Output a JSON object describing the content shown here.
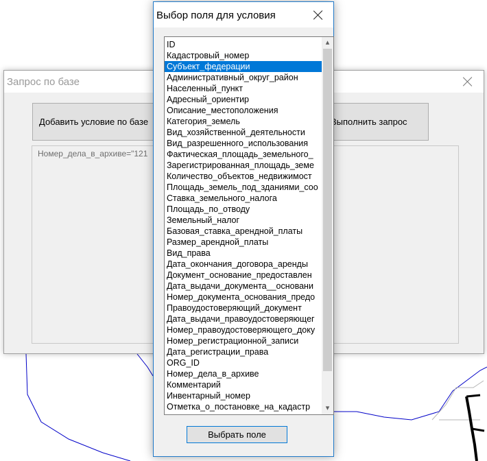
{
  "query_dialog": {
    "title": "Запрос по базе",
    "add_condition_label": "Добавить условие по базе",
    "run_query_label": "Выполнить запрос",
    "query_text": "Номер_дела_в_архиве=\"121"
  },
  "field_dialog": {
    "title": "Выбор поля для условия",
    "select_button_label": "Выбрать поле",
    "selected_index": 2,
    "items": [
      "ID",
      "Кадастровый_номер",
      "Субъект_федерации",
      "Административный_округ_район",
      "Населенный_пункт",
      "Адресный_ориентир",
      "Описание_местоположения",
      "Категория_земель",
      "Вид_хозяйственной_деятельности",
      "Вид_разрешенного_использования",
      "Фактическая_площадь_земельного_",
      "Зарегистрированная_площадь_земе",
      "Количество_объектов_недвижимост",
      "Площадь_земель_под_зданиями_соо",
      "Ставка_земельного_налога",
      "Площадь_по_отводу",
      "Земельный_налог",
      "Базовая_ставка_арендной_платы",
      "Размер_арендной_платы",
      "Вид_права",
      "Дата_окончания_договора_аренды",
      "Документ_основание_предоставлен",
      "Дата_выдачи_документа__основани",
      "Номер_документа_основания_предо",
      "Правоудостоверяющий_документ",
      "Дата_выдачи_правоудостоверяющег",
      "Номер_правоудостоверяющего_доку",
      "Номер_регистрационной_записи",
      "Дата_регистрации_права",
      "ORG_ID",
      "Номер_дела_в_архиве",
      "Комментарий",
      "Инвентарный_номер",
      "Отметка_о_постановке_на_кадастр"
    ]
  },
  "colors": {
    "selection": "#0078d7",
    "dialog_border": "#1e78c8",
    "map_line_blue": "#0000c8"
  }
}
